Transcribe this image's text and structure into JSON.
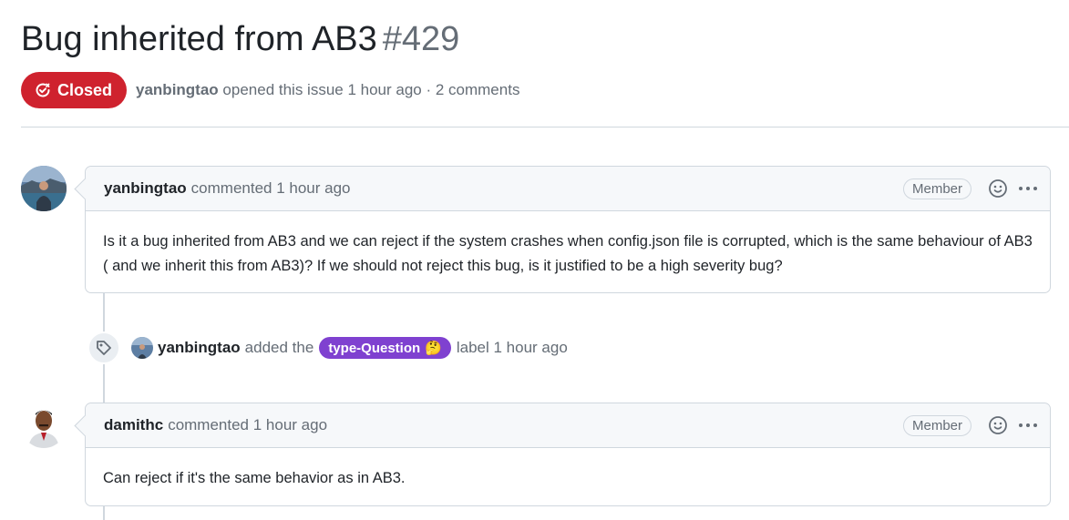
{
  "issue": {
    "title": "Bug inherited from AB3",
    "number": "#429",
    "state": "Closed",
    "author": "yanbingtao",
    "opened_text": "opened this issue 1 hour ago · 2 comments"
  },
  "comments": [
    {
      "author": "yanbingtao",
      "action": "commented 1 hour ago",
      "role": "Member",
      "body": "Is it a bug inherited from AB3 and we can reject if the system crashes when config.json file is corrupted, which is the same behaviour of AB3 ( and we inherit this from AB3)? If we should not reject this bug, is it justified to be a high severity bug?"
    },
    {
      "author": "damithc",
      "action": "commented 1 hour ago",
      "role": "Member",
      "body": "Can reject if it's the same behavior as in AB3."
    }
  ],
  "event": {
    "actor": "yanbingtao",
    "text_before": "added the",
    "label": "type-Question",
    "label_emoji": "🤔",
    "label_color": "#7f41d0",
    "text_after": "label 1 hour ago"
  },
  "colors": {
    "closed": "#cf222e",
    "border": "#d0d7de",
    "muted": "#656d76"
  },
  "icons": [
    "issue-closed-icon",
    "smiley-icon",
    "kebab-menu-icon",
    "tag-icon"
  ]
}
